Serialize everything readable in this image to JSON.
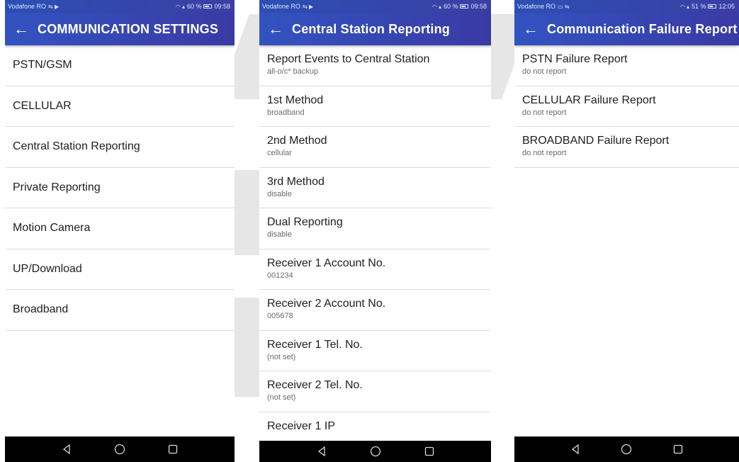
{
  "phones": [
    {
      "status": {
        "carrier": "Vodafone RO",
        "signal": "60 %",
        "time": "09:58"
      },
      "title": "COMMUNICATION SETTINGS",
      "items": [
        {
          "label": "PSTN/GSM"
        },
        {
          "label": "CELLULAR"
        },
        {
          "label": "Central Station Reporting"
        },
        {
          "label": "Private Reporting"
        },
        {
          "label": "Motion Camera"
        },
        {
          "label": "UP/Download"
        },
        {
          "label": "Broadband"
        }
      ]
    },
    {
      "status": {
        "carrier": "Vodafone RO",
        "signal": "60 %",
        "time": "09:58"
      },
      "title": "Central Station Reporting",
      "items": [
        {
          "label": "Report Events to Central Station",
          "value": "all-o/c* backup"
        },
        {
          "label": "1st Method",
          "value": "broadband"
        },
        {
          "label": "2nd Method",
          "value": "cellular"
        },
        {
          "label": "3rd Method",
          "value": "disable"
        },
        {
          "label": "Dual Reporting",
          "value": "disable"
        },
        {
          "label": "Receiver 1 Account No.",
          "value": "001234"
        },
        {
          "label": "Receiver 2 Account No.",
          "value": "005678"
        },
        {
          "label": "Receiver 1 Tel. No.",
          "value": "(not set)"
        },
        {
          "label": "Receiver 2 Tel. No.",
          "value": "(not set)"
        },
        {
          "label": "Receiver 1 IP"
        }
      ]
    },
    {
      "status": {
        "carrier": "Vodafone RO",
        "signal": "51 %",
        "time": "12:05"
      },
      "title": "Communication Failure Report",
      "items": [
        {
          "label": "PSTN Failure Report",
          "value": "do not report"
        },
        {
          "label": "CELLULAR Failure Report",
          "value": "do not report"
        },
        {
          "label": "BROADBAND Failure Report",
          "value": "do not report"
        }
      ]
    }
  ],
  "colors": {
    "app_bar": "#3446b4",
    "nav_bar": "#000000",
    "divider": "#dddddd"
  },
  "icons": {
    "back": "arrow-left-icon",
    "nav_back": "triangle-back-icon",
    "nav_home": "circle-home-icon",
    "nav_recents": "square-recents-icon"
  }
}
